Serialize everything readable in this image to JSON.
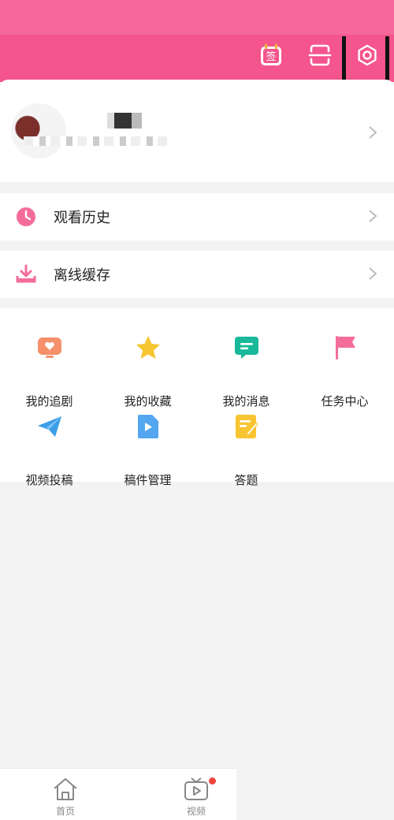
{
  "header": {
    "checkin_glyph": "签",
    "checkin_icon": "checkin-calendar-icon",
    "scan_icon": "scan-icon",
    "settings_icon": "gear-icon",
    "accent": "#f4558d"
  },
  "menu": {
    "history_label": "观看历史",
    "offline_label": "离线缓存"
  },
  "grid": [
    {
      "label": "我的追剧",
      "icon": "tv-heart-icon",
      "color": "#f6906b"
    },
    {
      "label": "我的收藏",
      "icon": "star-icon",
      "color": "#f7c531"
    },
    {
      "label": "我的消息",
      "icon": "message-icon",
      "color": "#19b89a"
    },
    {
      "label": "任务中心",
      "icon": "flag-icon",
      "color": "#f46d9a"
    },
    {
      "label": "视频投稿",
      "icon": "paper-plane-icon",
      "color": "#3b9ee8"
    },
    {
      "label": "稿件管理",
      "icon": "video-file-icon",
      "color": "#54a6f0"
    },
    {
      "label": "答题",
      "icon": "note-pencil-icon",
      "color": "#f7c531"
    }
  ],
  "tabbar": {
    "home_label": "首页",
    "video_label": "视频"
  }
}
